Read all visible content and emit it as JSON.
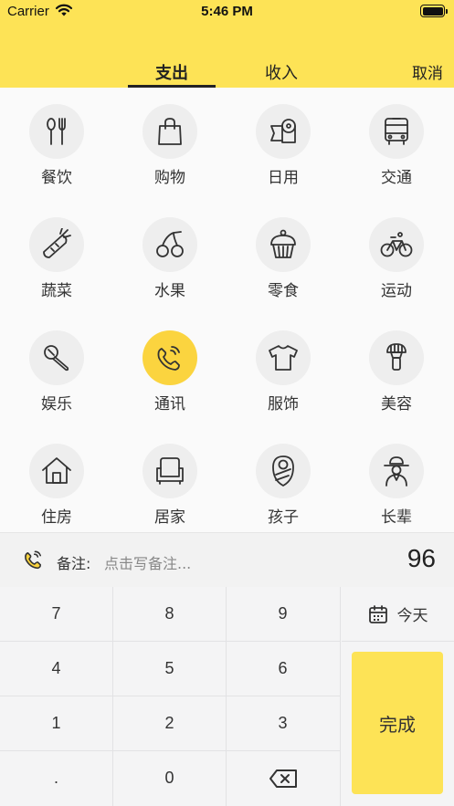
{
  "status_bar": {
    "carrier": "Carrier",
    "time": "5:46 PM"
  },
  "header": {
    "tab_expense": "支出",
    "tab_income": "收入",
    "cancel": "取消"
  },
  "categories": [
    {
      "label": "餐饮",
      "icon": "fork-spoon-icon"
    },
    {
      "label": "购物",
      "icon": "shopping-bag-icon"
    },
    {
      "label": "日用",
      "icon": "toilet-paper-icon"
    },
    {
      "label": "交通",
      "icon": "bus-icon"
    },
    {
      "label": "蔬菜",
      "icon": "carrot-icon"
    },
    {
      "label": "水果",
      "icon": "cherry-icon"
    },
    {
      "label": "零食",
      "icon": "cupcake-icon"
    },
    {
      "label": "运动",
      "icon": "bicycle-icon"
    },
    {
      "label": "娱乐",
      "icon": "microphone-icon"
    },
    {
      "label": "通讯",
      "icon": "phone-icon",
      "selected": true
    },
    {
      "label": "服饰",
      "icon": "tshirt-icon"
    },
    {
      "label": "美容",
      "icon": "makeup-brush-icon"
    },
    {
      "label": "住房",
      "icon": "house-icon"
    },
    {
      "label": "居家",
      "icon": "armchair-icon"
    },
    {
      "label": "孩子",
      "icon": "baby-icon"
    },
    {
      "label": "长辈",
      "icon": "elder-icon"
    }
  ],
  "remark": {
    "label": "备注:",
    "placeholder": "点击写备注...",
    "amount": "96",
    "icon": "phone-icon"
  },
  "keypad": {
    "keys": [
      "7",
      "8",
      "9",
      "4",
      "5",
      "6",
      "1",
      "2",
      "3",
      ".",
      "0"
    ],
    "today": "今天",
    "done": "完成"
  },
  "colors": {
    "accent": "#fde356",
    "selected": "#fbd43f"
  }
}
